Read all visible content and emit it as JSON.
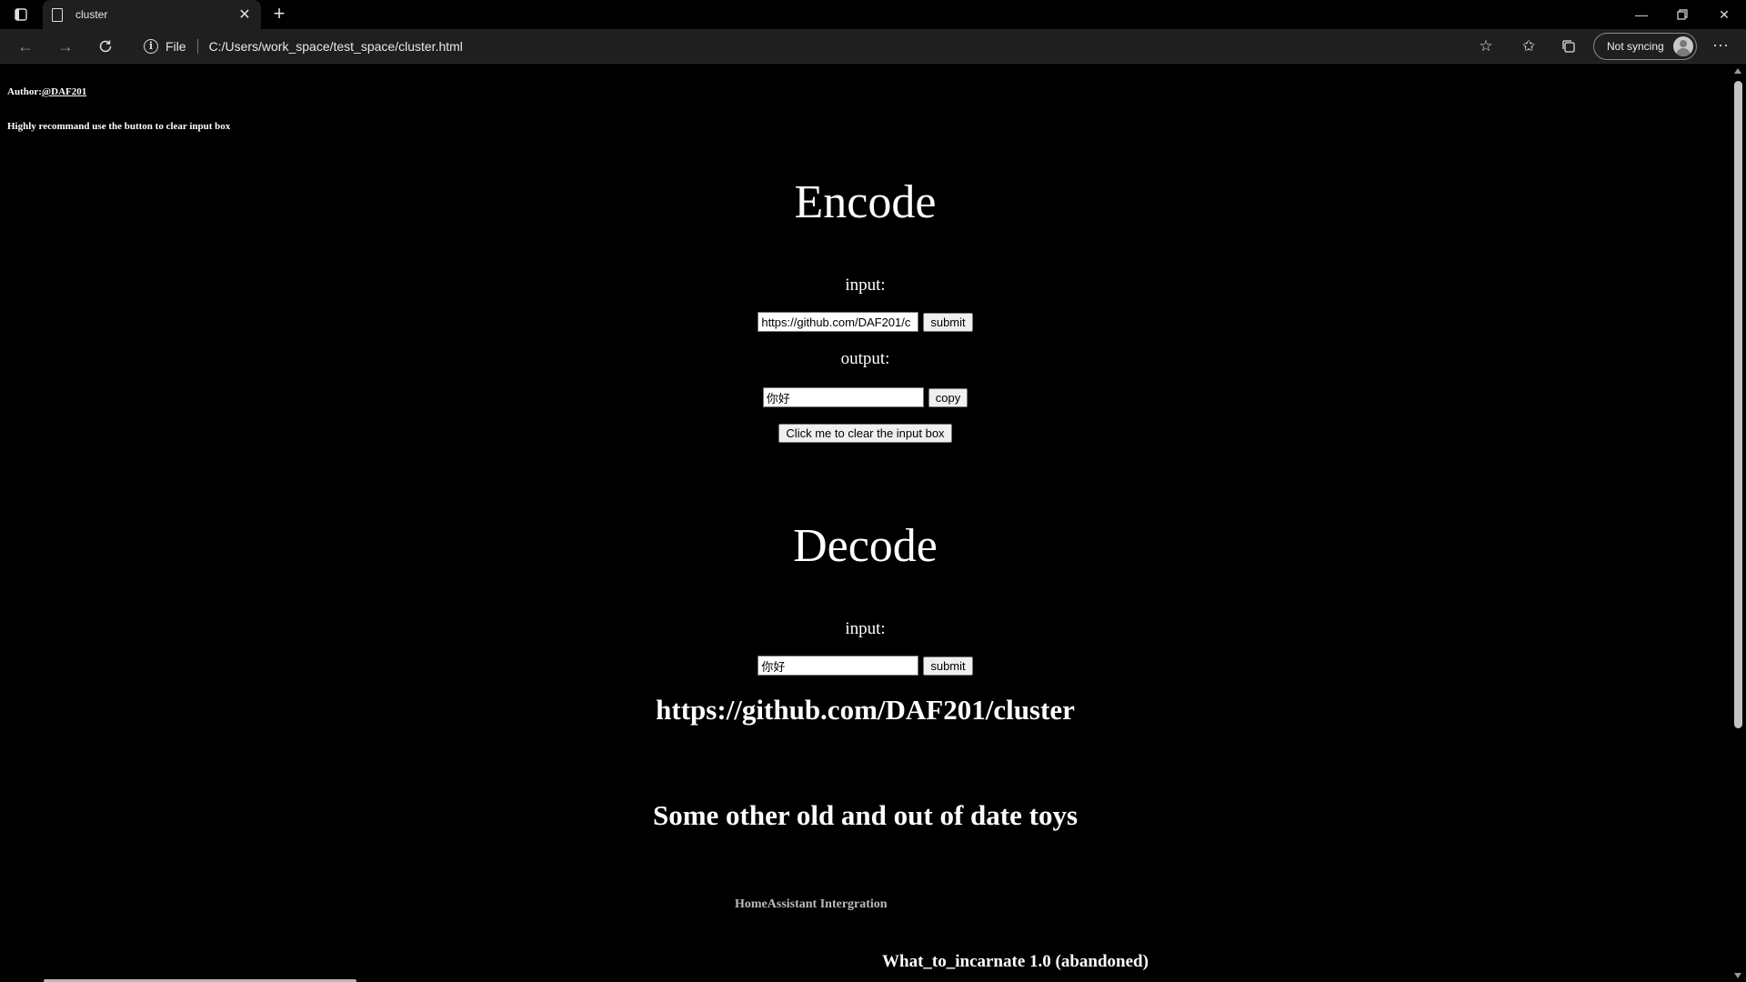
{
  "browser": {
    "tab_title": "cluster",
    "address_scheme": "File",
    "url": "C:/Users/work_space/test_space/cluster.html",
    "sync_label": "Not syncing"
  },
  "page": {
    "author_prefix": "Author:",
    "author_link": "@DAF201",
    "tip": "Highly recommand use the button to clear input box",
    "encode": {
      "heading": "Encode",
      "input_label": "input:",
      "input_value": "https://github.com/DAF201/c",
      "submit_label": "submit",
      "output_label": "output:",
      "output_value": "你好",
      "copy_label": "copy",
      "clear_label": "Click me to clear the input box"
    },
    "decode": {
      "heading": "Decode",
      "input_label": "input:",
      "input_value": "你好",
      "submit_label": "submit",
      "result": "https://github.com/DAF201/cluster"
    },
    "other": {
      "heading": "Some other old and out of date toys",
      "link1": "HomeAssistant Intergration",
      "project": "What_to_incarnate 1.0 (abandoned)"
    }
  }
}
